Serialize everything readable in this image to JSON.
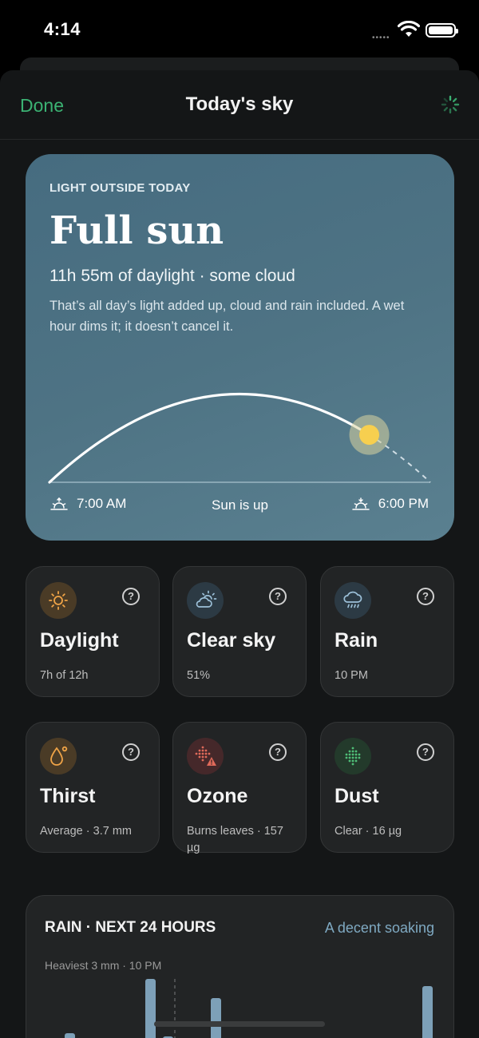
{
  "status_bar": {
    "time": "4:14",
    "signal_dots": "•••••"
  },
  "nav": {
    "done_label": "Done",
    "title": "Today's sky"
  },
  "hero": {
    "eyebrow": "LIGHT OUTSIDE TODAY",
    "title": "Full sun",
    "subtitle": "11h 55m of daylight · some cloud",
    "description": "That’s all day’s light added up, cloud and rain included. A wet hour dims it; it doesn’t cancel it.",
    "sunrise": "7:00 AM",
    "state": "Sun is up",
    "sunset": "6:00 PM",
    "sun_progress": 0.84
  },
  "tiles": [
    {
      "title": "Daylight",
      "subtitle": "7h of 12h",
      "icon": "sun-icon",
      "help": "?"
    },
    {
      "title": "Clear sky",
      "subtitle": "51%",
      "icon": "partly-cloudy-icon",
      "help": "?"
    },
    {
      "title": "Rain",
      "subtitle": "10 PM",
      "icon": "rain-cloud-icon",
      "help": "?"
    },
    {
      "title": "Thirst",
      "subtitle": "Average · 3.7 mm",
      "icon": "water-drop-icon",
      "help": "?"
    },
    {
      "title": "Ozone",
      "subtitle": "Burns leaves · 157 µg",
      "icon": "ozone-warning-icon",
      "help": "?"
    },
    {
      "title": "Dust",
      "subtitle": "Clear · 16 µg",
      "icon": "dust-icon",
      "help": "?"
    }
  ],
  "rain_card": {
    "title": "RAIN · NEXT 24 HOURS",
    "link": "A decent soaking",
    "note": "Heaviest 3 mm · 10 PM"
  },
  "colors": {
    "accent_green": "#3bb273",
    "hero_bg": "#4e7384",
    "sun": "#f7cf4f",
    "rain_bar": "#7da0b8",
    "link_blue": "#7fa9c2"
  }
}
